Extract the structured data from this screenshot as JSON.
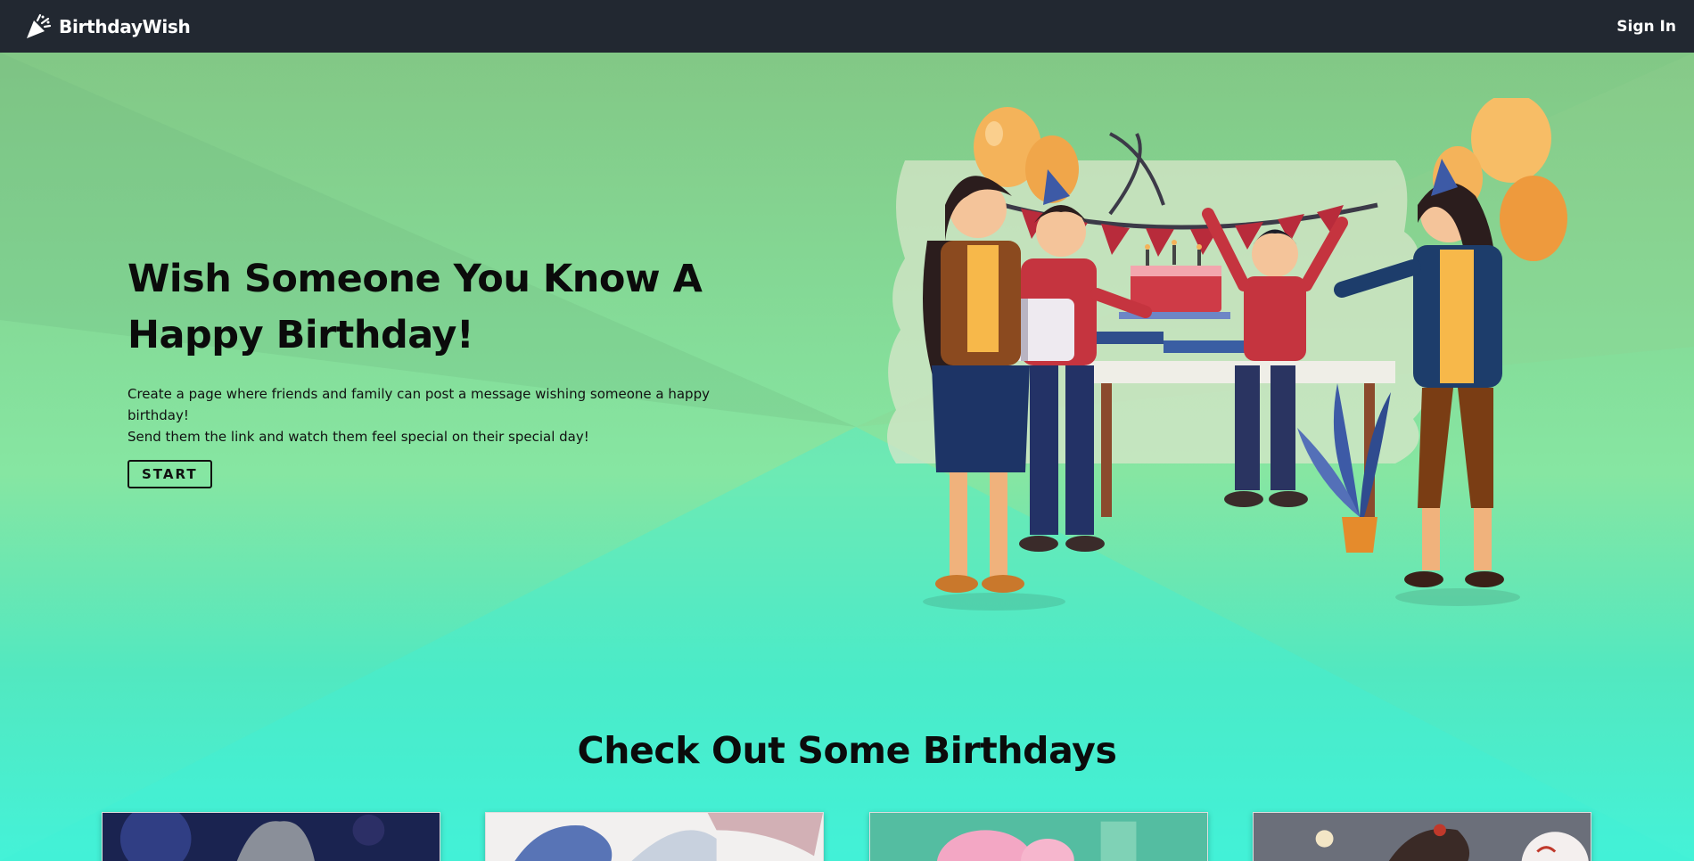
{
  "navbar": {
    "brand": "BirthdayWish",
    "brand_icon": "party-popper-icon",
    "signin_label": "Sign In",
    "background": "#222831"
  },
  "hero": {
    "title": "Wish Someone You Know A Happy Birthday!",
    "description_line1": "Create a page where friends and family can post a message wishing someone a happy birthday!",
    "description_line2": "Send them the link and watch them feel special on their special day!",
    "start_label": "START"
  },
  "section": {
    "title": "Check Out Some Birthdays"
  },
  "colors": {
    "gradient_top": "#82c482",
    "gradient_bottom": "#44f2d8",
    "text_dark": "#0b0b0b"
  }
}
